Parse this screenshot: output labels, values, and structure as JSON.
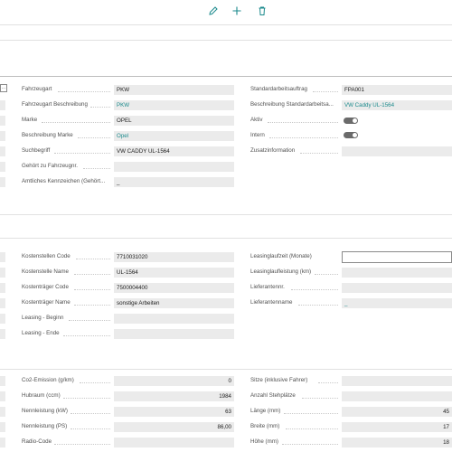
{
  "toolbar": {
    "edit_icon": "pencil-icon",
    "new_icon": "plus-icon",
    "delete_icon": "trash-icon",
    "accent": "#1b8a8c"
  },
  "ellipsis": "...",
  "general": {
    "fahrzeugart": {
      "label": "Fahrzeugart",
      "value": "PKW"
    },
    "fahrzeugart_beschreibung": {
      "label": "Fahrzeugart Beschreibung",
      "value": "PKW"
    },
    "marke": {
      "label": "Marke",
      "value": "OPEL"
    },
    "beschreibung_marke": {
      "label": "Beschreibung Marke",
      "value": "Opel"
    },
    "suchbegriff": {
      "label": "Suchbegriff",
      "value": "VW CADDY UL-1564"
    },
    "gehoert_zu": {
      "label": "Gehört zu Fahrzeugnr.",
      "value": ""
    },
    "kennzeichen": {
      "label": "Amtliches Kennzeichen (Gehört...",
      "value": "_"
    },
    "standardarbeitsauftrag": {
      "label": "Standardarbeitsauftrag",
      "value": "FPA001"
    },
    "beschreibung_standard": {
      "label": "Beschreibung Standardarbeitsa...",
      "value": "VW Caddy UL-1564"
    },
    "aktiv": {
      "label": "Aktiv",
      "on": true
    },
    "intern": {
      "label": "Intern",
      "on": true
    },
    "zusatzinformation": {
      "label": "Zusatzinformation",
      "value": ""
    }
  },
  "cost": {
    "kostenstelle_code": {
      "label": "Kostenstellen Code",
      "value": "7710031020"
    },
    "kostenstelle_name": {
      "label": "Kostenstelle Name",
      "value": "UL-1564"
    },
    "kostentraeger_code": {
      "label": "Kostenträger Code",
      "value": "7500004400"
    },
    "kostentraeger_name": {
      "label": "Kostenträger Name",
      "value": "sonstige Arbeiten"
    },
    "leasing_beginn": {
      "label": "Leasing - Beginn",
      "value": ""
    },
    "leasing_ende": {
      "label": "Leasing - Ende",
      "value": ""
    },
    "leasing_laufzeit": {
      "label": "Leasinglaufzeit (Monate)",
      "value": ""
    },
    "leasing_laufleistung": {
      "label": "Leasinglaufleistung (km)",
      "value": ""
    },
    "lieferantennr": {
      "label": "Lieferantennr.",
      "value": ""
    },
    "lieferantenname": {
      "label": "Lieferantenname",
      "value": "_"
    }
  },
  "tech": {
    "co2": {
      "label": "Co2-Emission (g/km)",
      "value": "0"
    },
    "hubraum": {
      "label": "Hubraum (ccm)",
      "value": "1984"
    },
    "kw": {
      "label": "Nennleistung (kW)",
      "value": "63"
    },
    "ps": {
      "label": "Nennleistung (PS)",
      "value": "86,00"
    },
    "radio": {
      "label": "Radio-Code",
      "value": ""
    },
    "sitze": {
      "label": "Sitze (inklusive Fahrer)",
      "value": ""
    },
    "stehplaetze": {
      "label": "Anzahl Stehplätze",
      "value": ""
    },
    "laenge": {
      "label": "Länge (mm)",
      "value": "45"
    },
    "breite": {
      "label": "Breite (mm)",
      "value": "17"
    },
    "hoehe": {
      "label": "Höhe (mm)",
      "value": "18"
    }
  }
}
